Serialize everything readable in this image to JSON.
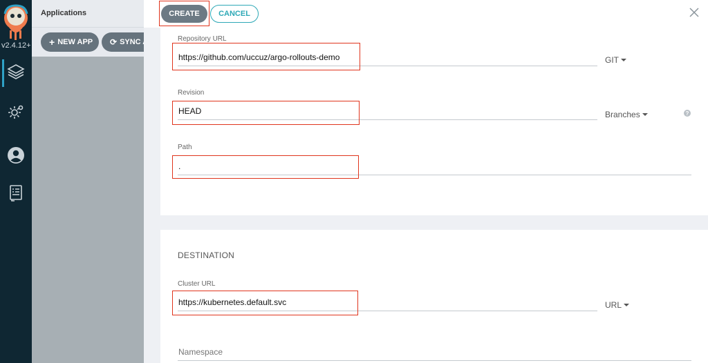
{
  "nav": {
    "version": "v2.4.12+",
    "items": [
      {
        "icon": "layers-icon",
        "active": true
      },
      {
        "icon": "gear-icon",
        "active": false
      },
      {
        "icon": "user-icon",
        "active": false
      },
      {
        "icon": "docs-icon",
        "active": false
      }
    ]
  },
  "background_app": {
    "title": "Applications",
    "new_app_label": "NEW APP",
    "sync_label": "SYNC A"
  },
  "panel": {
    "create_label": "CREATE",
    "cancel_label": "CANCEL",
    "source": {
      "repo_url_label": "Repository URL",
      "repo_url_value": "https://github.com/uccuz/argo-rollouts-demo",
      "repo_type": "GIT",
      "revision_label": "Revision",
      "revision_value": "HEAD",
      "revision_type": "Branches",
      "path_label": "Path",
      "path_value": "."
    },
    "destination": {
      "section_title": "DESTINATION",
      "cluster_url_label": "Cluster URL",
      "cluster_url_value": "https://kubernetes.default.svc",
      "cluster_type": "URL",
      "namespace_placeholder": "Namespace"
    }
  },
  "colors": {
    "highlight": "#e0341c",
    "accent": "#2da8b6",
    "nav_bg": "#0f2733"
  }
}
